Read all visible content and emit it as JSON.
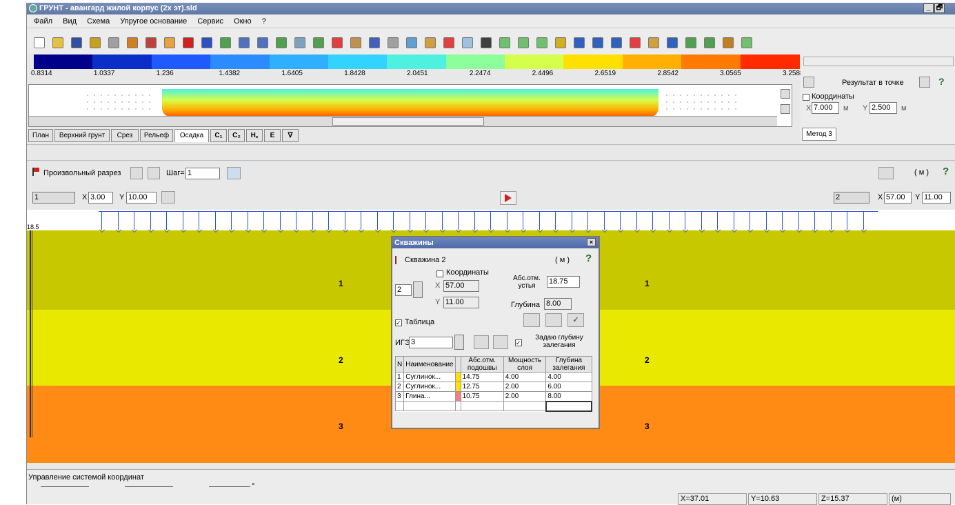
{
  "window": {
    "title": "ГРУНТ - авангард жилой корпус (2х эт).sld",
    "minimize": "_",
    "maximize": "🗗"
  },
  "menu": [
    "Файл",
    "Вид",
    "Схема",
    "Упругое основание",
    "Сервис",
    "Окно",
    "?"
  ],
  "legend": {
    "ticks": [
      "0.8314",
      "1.0337",
      "1.236",
      "1.4382",
      "1.6405",
      "1.8428",
      "2.0451",
      "2.2474",
      "2.4496",
      "2.6519",
      "2.8542",
      "3.0565",
      "3.2588"
    ],
    "colors": [
      "#00008b",
      "#0a2fc8",
      "#1e5aff",
      "#2b8cff",
      "#2fb0ff",
      "#33d3ff",
      "#4ef0e0",
      "#8cff9a",
      "#d4ff4a",
      "#ffe000",
      "#ffb000",
      "#ff7a00",
      "#ff2a00"
    ]
  },
  "tabs": [
    "План",
    "Верхний грунт",
    "Срез",
    "Рельеф",
    "Осадка",
    "C₁",
    "C₂",
    "H꜀",
    "E",
    "∇"
  ],
  "right_panel": {
    "point_result": "Результат в точке",
    "coords_label": "Координаты",
    "x_label": "X",
    "x_value": "7.000",
    "y_label": "Y",
    "y_value": "2.500",
    "unit": "м",
    "method_tab": "Метод 3",
    "help": "?"
  },
  "section_bar": {
    "label": "Произвольный разрез",
    "step_label": "Шаг=",
    "step_value": "1",
    "units": "( м )",
    "help": "?"
  },
  "left_point": {
    "num": "1",
    "x_label": "X",
    "x": "3.00",
    "y_label": "Y",
    "y": "10.00"
  },
  "right_point": {
    "num": "2",
    "x_label": "X",
    "x": "57.00",
    "y_label": "Y",
    "y": "11.00"
  },
  "canvas": {
    "top_tick": "18.5",
    "layers": [
      {
        "num": "1",
        "color": "#c8c800"
      },
      {
        "num": "2",
        "color": "#e8e800"
      },
      {
        "num": "3",
        "color": "#ff8a14"
      }
    ]
  },
  "dialog": {
    "title": "Скважины",
    "close": "×",
    "well_name": "Скважина 2",
    "units": "( м )",
    "help": "?",
    "well_num": "2",
    "coords_label": "Координаты",
    "x_label": "X",
    "x": "57.00",
    "y_label": "Y",
    "y": "11.00",
    "abs_label": "Абс.отм. устья",
    "abs_value": "18.75",
    "depth_label": "Глубина",
    "depth_value": "8.00",
    "table_check": "Таблица",
    "ige_label": "ИГЭ",
    "ige_value": "3",
    "depth_check": "Задаю глубину залегания",
    "columns": [
      "N",
      "Наименование",
      "",
      "Абс.отм. подошвы",
      "Мощность слоя",
      "Глубина залегания"
    ],
    "rows": [
      {
        "n": "1",
        "name": "Суглинок...",
        "color": "#ffe000",
        "abs": "14.75",
        "thick": "4.00",
        "depth": "4.00"
      },
      {
        "n": "2",
        "name": "Суглинок...",
        "color": "#ffe000",
        "abs": "12.75",
        "thick": "2.00",
        "depth": "6.00"
      },
      {
        "n": "3",
        "name": "Глина...",
        "color": "#f08080",
        "abs": "10.75",
        "thick": "2.00",
        "depth": "8.00"
      }
    ]
  },
  "status": {
    "label": "Управление системой координат",
    "x": "X=37.01",
    "y": "Y=10.63",
    "z": "Z=15.37",
    "unit": "(м)",
    "deg": "°"
  }
}
